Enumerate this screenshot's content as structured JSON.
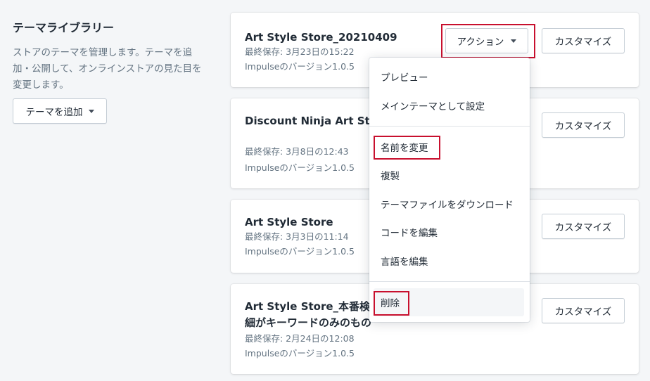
{
  "library": {
    "title": "テーマライブラリー",
    "description": "ストアのテーマを管理します。テーマを追加・公開して、オンラインストアの見た目を変更します。",
    "add_theme_label": "テーマを追加"
  },
  "themes": [
    {
      "name": "Art Style Store_20210409",
      "saved": "最終保存: 3月23日の15:22",
      "version": "Impulseのバージョン1.0.5",
      "customize_label": "カスタマイズ",
      "action_label": "アクション"
    },
    {
      "name": "Discount Ninja Art Style",
      "saved": "最終保存: 3月8日の12:43",
      "version": "Impulseのバージョン1.0.5",
      "customize_label": "カスタマイズ"
    },
    {
      "name": "Art Style Store",
      "saved": "最終保存: 3月3日の11:14",
      "version": "Impulseのバージョン1.0.5",
      "customize_label": "カスタマイズ"
    },
    {
      "name_line1": "Art Style Store_本番検証",
      "name_line2": "細がキーワードのみのもの",
      "saved": "最終保存: 2月24日の12:08",
      "version": "Impulseのバージョン1.0.5",
      "customize_label": "カスタマイズ"
    }
  ],
  "action_menu": {
    "items": [
      {
        "label": "プレビュー"
      },
      {
        "label": "メインテーマとして設定"
      },
      {
        "label": "名前を変更"
      },
      {
        "label": "複製"
      },
      {
        "label": "テーマファイルをダウンロード"
      },
      {
        "label": "コードを編集"
      },
      {
        "label": "言語を編集"
      },
      {
        "label": "削除"
      }
    ]
  },
  "colors": {
    "highlight": "#c8102e",
    "background": "#f4f6f8",
    "text": "#212b36",
    "subdued": "#637381"
  }
}
